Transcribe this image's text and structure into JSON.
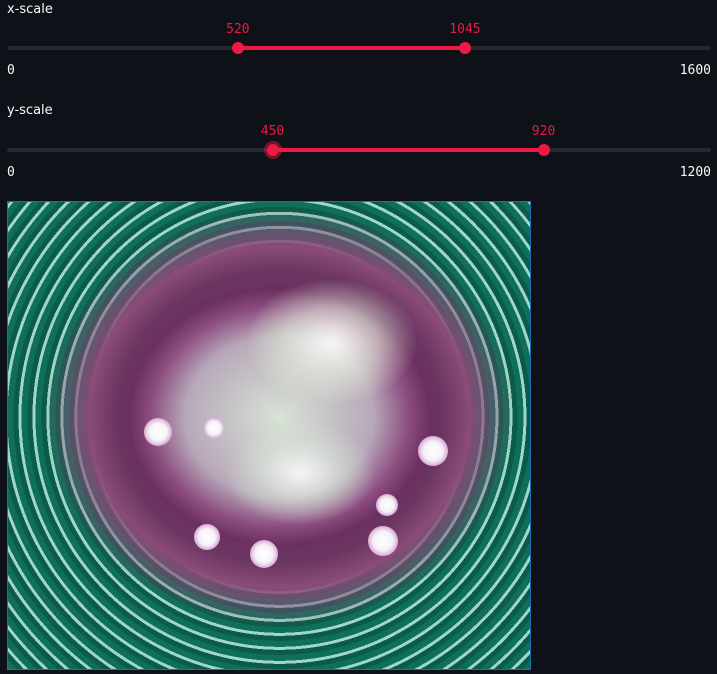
{
  "x_slider": {
    "label": "x-scale",
    "min_label": "0",
    "max_label": "1600",
    "min": 0,
    "max": 1600,
    "low": 520,
    "high": 1045,
    "low_label": "520",
    "high_label": "1045"
  },
  "y_slider": {
    "label": "y-scale",
    "min_label": "0",
    "max_label": "1200",
    "min": 0,
    "max": 1200,
    "low": 450,
    "high": 920,
    "low_label": "450",
    "high_label": "920"
  },
  "colors": {
    "background": "#0e1117",
    "accent": "#ee1a43",
    "track": "#262730",
    "text": "#fafafa"
  }
}
